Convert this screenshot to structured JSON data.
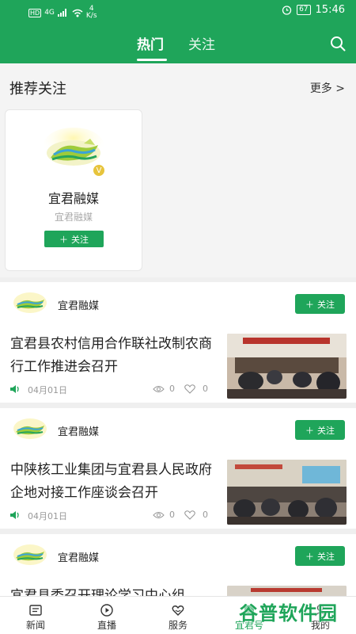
{
  "status_bar": {
    "network": "HD",
    "signal": "4G",
    "speed_value": "4",
    "speed_unit": "K/s",
    "battery": "67",
    "time": "15:46"
  },
  "tabs": [
    {
      "label": "热门",
      "active": true
    },
    {
      "label": "关注",
      "active": false
    }
  ],
  "recommend": {
    "title": "推荐关注",
    "more_label": "更多 >",
    "card": {
      "name": "宜君融媒",
      "subtitle": "宜君融媒",
      "follow_label": "关注",
      "verified_badge": "V"
    }
  },
  "posts": [
    {
      "author": "宜君融媒",
      "follow_label": "关注",
      "title": "宜君县农村信用合作联社改制农商行工作推进会召开",
      "date": "04月01日",
      "views": "0",
      "likes": "0"
    },
    {
      "author": "宜君融媒",
      "follow_label": "关注",
      "title": "中陕核工业集团与宜君县人民政府企地对接工作座谈会召开",
      "date": "04月01日",
      "views": "0",
      "likes": "0"
    },
    {
      "author": "宜君融媒",
      "follow_label": "关注",
      "title": "宜君县委召开理论学习中心组",
      "date": "",
      "views": "",
      "likes": ""
    }
  ],
  "bottom_nav": [
    {
      "label": "新闻",
      "icon": "news-icon",
      "active": false
    },
    {
      "label": "直播",
      "icon": "play-icon",
      "active": false
    },
    {
      "label": "服务",
      "icon": "service-icon",
      "active": false
    },
    {
      "label": "宜君号",
      "icon": "account-icon",
      "active": true
    },
    {
      "label": "我的",
      "icon": "profile-icon",
      "active": false
    }
  ],
  "watermark": "谷普软件园",
  "colors": {
    "brand_green": "#1fa55a",
    "badge_gold": "#e7c43c"
  }
}
